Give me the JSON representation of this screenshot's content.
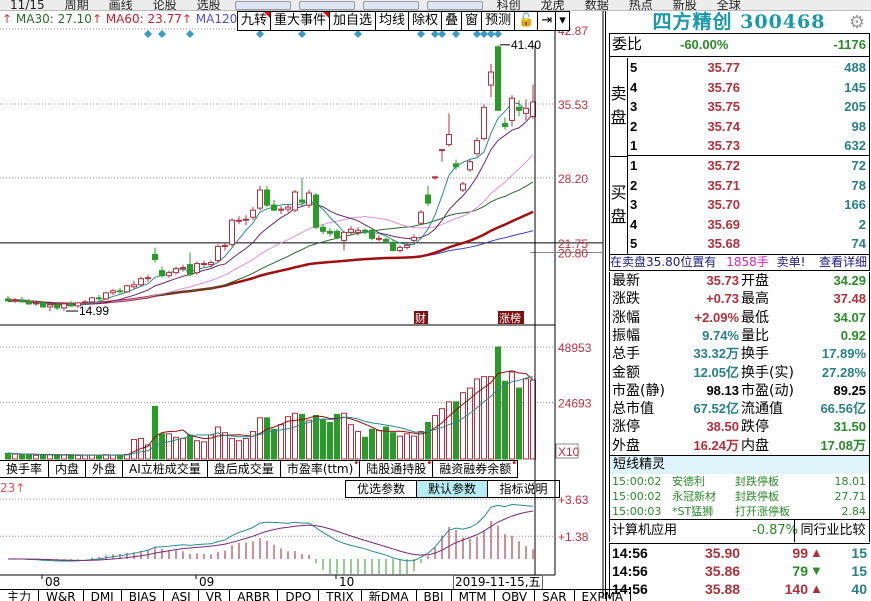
{
  "menu": {
    "items": [
      "11/15",
      "周期",
      "画线",
      "论股",
      "选股",
      "科创",
      "龙虎",
      "数据",
      "热点",
      "新股",
      "全球"
    ]
  },
  "legend": {
    "ma30": "MA30: 27.10",
    "ma60": "MA60: 23.77",
    "ma120": "MA120:",
    "arrow": "↑"
  },
  "toolbar": [
    "九转",
    "重大事件",
    "加自选",
    "均线",
    "除权",
    "叠",
    "窗",
    "预测",
    "🔓",
    "⇥",
    "▾"
  ],
  "price_axis": {
    "labels": [
      "42.87",
      "35.53",
      "28.20",
      "21.75",
      "20.80"
    ],
    "high_mark": "41.40",
    "low_mark": "14.99"
  },
  "volume_axis": {
    "labels": [
      "48953",
      "24693"
    ],
    "multiplier": "X10"
  },
  "macd_axis": {
    "labels": [
      "+3.63",
      "+1.38"
    ],
    "indicator_label": "23↑"
  },
  "event_badges": [
    {
      "bar": 59,
      "label": "财"
    },
    {
      "bar": 71,
      "label": "涨榜"
    }
  ],
  "event_markers": [
    20,
    22,
    26,
    36,
    42,
    50,
    59,
    61,
    62,
    64,
    67,
    68,
    69,
    70
  ],
  "chart_data": {
    "type": "candlestick",
    "ohlc": [
      [
        16.2,
        16.5,
        15.9,
        16.0
      ],
      [
        16.0,
        16.3,
        15.8,
        16.1
      ],
      [
        16.1,
        16.4,
        15.9,
        15.9
      ],
      [
        15.9,
        16.2,
        15.6,
        15.7
      ],
      [
        15.7,
        16.0,
        15.5,
        15.8
      ],
      [
        15.8,
        16.0,
        15.3,
        15.4
      ],
      [
        15.4,
        15.7,
        15.0,
        15.6
      ],
      [
        15.6,
        15.9,
        15.1,
        15.3
      ],
      [
        15.3,
        15.8,
        14.99,
        15.7
      ],
      [
        15.7,
        16.0,
        15.4,
        15.5
      ],
      [
        15.5,
        15.9,
        15.3,
        15.8
      ],
      [
        15.8,
        16.1,
        15.6,
        15.9
      ],
      [
        15.9,
        16.4,
        15.8,
        16.3
      ],
      [
        16.3,
        16.6,
        16.0,
        16.2
      ],
      [
        16.2,
        16.9,
        16.1,
        16.8
      ],
      [
        16.8,
        17.2,
        16.6,
        17.0
      ],
      [
        17.0,
        17.3,
        16.7,
        16.9
      ],
      [
        16.9,
        17.6,
        16.8,
        17.5
      ],
      [
        17.4,
        18.0,
        17.2,
        17.6
      ],
      [
        17.6,
        18.4,
        17.5,
        18.2
      ],
      [
        18.2,
        18.6,
        17.9,
        18.3
      ],
      [
        20.6,
        21.3,
        19.8,
        20.1
      ],
      [
        19.0,
        19.4,
        18.3,
        18.5
      ],
      [
        18.5,
        19.0,
        18.3,
        18.8
      ],
      [
        18.8,
        19.4,
        18.6,
        19.2
      ],
      [
        19.2,
        19.6,
        18.9,
        19.3
      ],
      [
        19.6,
        20.8,
        18.4,
        18.6
      ],
      [
        18.8,
        19.9,
        18.6,
        19.7
      ],
      [
        19.7,
        20.0,
        19.4,
        19.7
      ],
      [
        19.6,
        20.0,
        19.3,
        19.8
      ],
      [
        20.0,
        21.6,
        19.8,
        21.4
      ],
      [
        21.4,
        21.8,
        21.0,
        21.5
      ],
      [
        21.6,
        24.2,
        21.4,
        24.0
      ],
      [
        24.0,
        24.4,
        23.6,
        24.0
      ],
      [
        24.0,
        24.5,
        23.5,
        24.1
      ],
      [
        24.3,
        25.3,
        24.0,
        25.0
      ],
      [
        25.2,
        27.4,
        25.0,
        27.0
      ],
      [
        27.0,
        27.4,
        25.3,
        25.5
      ],
      [
        25.5,
        26.0,
        24.9,
        25.0
      ],
      [
        25.0,
        25.4,
        24.6,
        25.1
      ],
      [
        25.1,
        25.6,
        24.8,
        25.3
      ],
      [
        25.0,
        27.0,
        24.8,
        26.8
      ],
      [
        26.0,
        28.2,
        25.4,
        25.8
      ],
      [
        25.5,
        27.0,
        25.2,
        26.7
      ],
      [
        26.5,
        26.7,
        23.1,
        23.3
      ],
      [
        23.3,
        23.6,
        22.6,
        22.9
      ],
      [
        22.9,
        23.2,
        22.4,
        22.7
      ],
      [
        22.9,
        23.1,
        22.1,
        22.3
      ],
      [
        22.0,
        22.9,
        21.0,
        22.8
      ],
      [
        22.8,
        23.4,
        22.6,
        23.1
      ],
      [
        22.8,
        23.3,
        22.5,
        23.0
      ],
      [
        23.0,
        23.2,
        22.6,
        22.9
      ],
      [
        23.0,
        23.2,
        22.0,
        22.2
      ],
      [
        22.2,
        22.5,
        21.9,
        22.2
      ],
      [
        22.1,
        22.3,
        21.7,
        21.9
      ],
      [
        21.8,
        22.0,
        20.9,
        21.0
      ],
      [
        21.0,
        21.5,
        20.8,
        21.3
      ],
      [
        21.3,
        21.7,
        21.1,
        21.5
      ],
      [
        22.0,
        22.6,
        21.8,
        22.3
      ],
      [
        23.7,
        25.0,
        23.5,
        24.8
      ],
      [
        26.5,
        27.4,
        25.4,
        25.7
      ],
      [
        28.2,
        28.4,
        28.0,
        28.3
      ],
      [
        31.0,
        31.1,
        29.8,
        31.0
      ],
      [
        31.5,
        34.6,
        31.3,
        32.5
      ],
      [
        29.6,
        30.0,
        29.0,
        29.3
      ],
      [
        27.0,
        27.8,
        26.8,
        27.6
      ],
      [
        29.0,
        30.0,
        28.8,
        29.8
      ],
      [
        30.6,
        32.2,
        30.4,
        31.9
      ],
      [
        32.1,
        35.5,
        31.9,
        35.2
      ],
      [
        37.4,
        39.5,
        36.2,
        38.7
      ],
      [
        41.2,
        41.4,
        34.9,
        34.9
      ],
      [
        33.6,
        34.2,
        33.0,
        33.3
      ],
      [
        33.9,
        36.4,
        33.3,
        36.1
      ],
      [
        35.2,
        35.9,
        34.3,
        34.9
      ],
      [
        34.6,
        36.0,
        33.9,
        35.1
      ],
      [
        34.29,
        37.48,
        34.07,
        35.73
      ]
    ],
    "volume": [
      2500,
      2200,
      1800,
      2000,
      1600,
      2000,
      1900,
      1500,
      1800,
      1700,
      1600,
      1800,
      1700,
      1600,
      1900,
      1700,
      1800,
      2000,
      8500,
      9000,
      6200,
      23000,
      11000,
      11000,
      9500,
      9000,
      10500,
      8000,
      7500,
      10500,
      14000,
      11500,
      9000,
      8000,
      9000,
      12000,
      18000,
      18000,
      13000,
      15000,
      18500,
      20000,
      19500,
      17000,
      19000,
      17000,
      16000,
      19500,
      20000,
      15000,
      12000,
      9500,
      13000,
      12500,
      14000,
      11500,
      10000,
      11000,
      10000,
      12000,
      16000,
      19000,
      22000,
      25000,
      25000,
      29000,
      31000,
      35000,
      36000,
      36000,
      48953,
      34000,
      38000,
      31000,
      35000,
      34500
    ],
    "x_ticks": [
      {
        "bar": 5,
        "label": "08"
      },
      {
        "bar": 27,
        "label": "09"
      },
      {
        "bar": 47,
        "label": "10"
      }
    ],
    "cursor_date": "2019-11-15,五",
    "colors": {
      "up": "#b03040",
      "down": "#2a9a2a",
      "ma5": "#2a8a8a",
      "ma10": "#6a2a6a",
      "ma20": "#e090e0",
      "ma30": "#2a6a2a",
      "ma60": "#a01010",
      "ma120": "#4040c0"
    }
  },
  "indicator_tabs": [
    "换手率",
    "内盘",
    "外盘",
    "AI立桩成交量",
    "盘后成交量",
    "市盈率(ttm)",
    "陆股通持股",
    "融资融券余额"
  ],
  "macd_buttons": [
    "优选参数",
    "默认参数",
    "指标说明"
  ],
  "bottom_tabs": [
    "主力",
    "W&R",
    "DMI",
    "BIAS",
    "ASI",
    "VR",
    "ARBR",
    "DPO",
    "TRIX",
    "新DMA",
    "BBI",
    "MTM",
    "OBV",
    "SAR",
    "EXPMA"
  ],
  "stock": {
    "name_code": "四方精创 300468"
  },
  "orderbook": {
    "weibi_label": "委比",
    "weibi_pct": "-60.00%",
    "weibi_diff": "-1176",
    "sell_label": "卖盘",
    "buy_label": "买盘",
    "sell": [
      {
        "lv": "5",
        "price": "35.77",
        "vol": "488"
      },
      {
        "lv": "4",
        "price": "35.76",
        "vol": "145"
      },
      {
        "lv": "3",
        "price": "35.75",
        "vol": "205"
      },
      {
        "lv": "2",
        "price": "35.74",
        "vol": "98"
      },
      {
        "lv": "1",
        "price": "35.73",
        "vol": "632"
      }
    ],
    "buy": [
      {
        "lv": "1",
        "price": "35.72",
        "vol": "72"
      },
      {
        "lv": "2",
        "price": "35.71",
        "vol": "78"
      },
      {
        "lv": "3",
        "price": "35.70",
        "vol": "166"
      },
      {
        "lv": "4",
        "price": "35.69",
        "vol": "2"
      },
      {
        "lv": "5",
        "price": "35.68",
        "vol": "74"
      }
    ],
    "notice": {
      "text": "在卖盘35.80位置有",
      "qty": "1858手",
      "suffix": "卖单!",
      "link": "查看详细"
    }
  },
  "stats": [
    [
      "最新",
      "35.73",
      "red",
      "开盘",
      "34.29",
      "grn"
    ],
    [
      "涨跌",
      "+0.73",
      "red",
      "最高",
      "37.48",
      "red"
    ],
    [
      "涨幅",
      "+2.09%",
      "red",
      "最低",
      "34.07",
      "grn"
    ],
    [
      "振幅",
      "9.74%",
      "teal",
      "量比",
      "0.92",
      "grn"
    ],
    [
      "总手",
      "33.32万",
      "teal",
      "换手",
      "17.89%",
      "teal"
    ],
    [
      "金额",
      "12.05亿",
      "teal",
      "换手(实)",
      "27.28%",
      "teal"
    ],
    [
      "市盈(静)",
      "98.13",
      "blk",
      "市盈(动)",
      "89.25",
      "blk"
    ],
    [
      "总市值",
      "67.52亿",
      "teal",
      "流通值",
      "66.56亿",
      "teal"
    ],
    [
      "涨停",
      "38.50",
      "red",
      "跌停",
      "31.50",
      "grn"
    ],
    [
      "外盘",
      "16.24万",
      "red",
      "内盘",
      "17.08万",
      "grn"
    ]
  ],
  "spirit": {
    "title": "短线精灵",
    "rows": [
      [
        "15:00:02",
        "安德利",
        "封跌停板",
        "18.01"
      ],
      [
        "15:00:02",
        "永冠新材",
        "封跌停板",
        "27.71"
      ],
      [
        "15:00:03",
        "*ST猛狮",
        "打开涨停板",
        "2.84"
      ]
    ]
  },
  "industry": {
    "name": "计算机应用",
    "change": "-0.87%",
    "compare": "同行业比较"
  },
  "ticks": [
    [
      "14:56",
      "35.90",
      "99",
      "up",
      "15"
    ],
    [
      "14:56",
      "35.86",
      "79",
      "down",
      "15"
    ],
    [
      "14:56",
      "35.88",
      "140",
      "up",
      "40"
    ]
  ]
}
